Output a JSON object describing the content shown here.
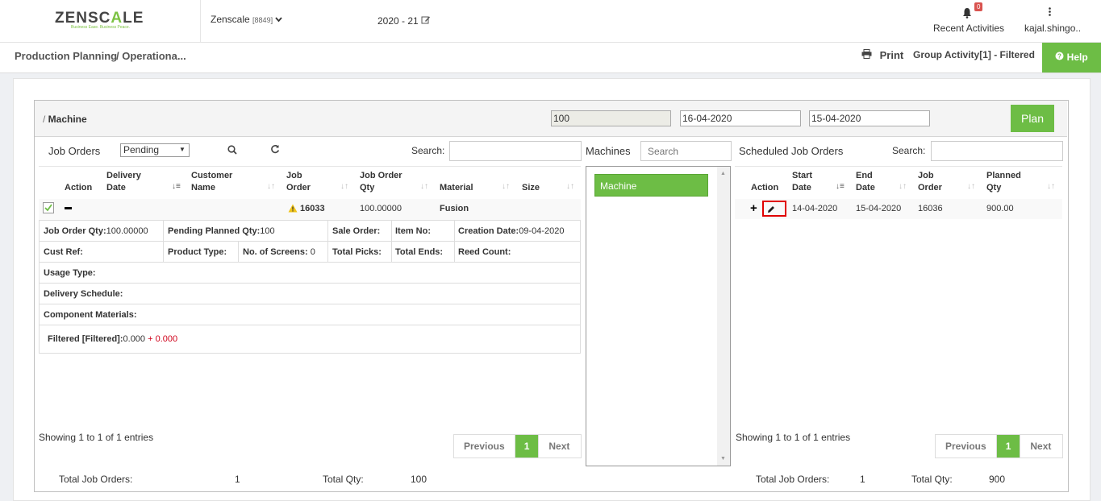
{
  "header": {
    "logo_prefix": "ZENSC",
    "logo_accent": "A",
    "logo_suffix": "LE",
    "logo_tagline": "Business Ease. Business Peace.",
    "company": "Zenscale",
    "company_code": "[8849]",
    "fiscal_year": "2020 - 21",
    "notification_count": "0",
    "recent_activities": "Recent Activities",
    "user": "kajal.shingo.."
  },
  "breadcrumb": {
    "item1": "Production Planning",
    "item2": "/ Operationa..."
  },
  "toolbar": {
    "print": "Print",
    "group_activity": "Group Activity[1] - Filtered",
    "help": "Help"
  },
  "panel": {
    "title_prefix": "/ ",
    "title": "Machine",
    "capacity": "100",
    "from_date": "16-04-2020",
    "to_date": "15-04-2020",
    "plan_label": "Plan"
  },
  "job_orders": {
    "title": "Job Orders",
    "filter": "Pending",
    "search_label": "Search:",
    "columns": [
      "Action",
      "Delivery Date",
      "Customer Name",
      "Job Order",
      "Job Order Qty",
      "Material",
      "Size"
    ],
    "row": {
      "job_order": "16033",
      "qty": "100.00000",
      "material": "Fusion"
    },
    "detail": {
      "jo_qty_label": "Job Order Qty:",
      "jo_qty": "100.00000",
      "pending_label": "Pending Planned Qty:",
      "pending": "100",
      "sale_order": "Sale Order:",
      "item_no": "Item No:",
      "creation_label": "Creation Date:",
      "creation": "09-04-2020",
      "cust_ref": "Cust Ref:",
      "product_type": "Product Type:",
      "screens_label": "No. of Screens:",
      "screens": "0",
      "total_picks": "Total Picks:",
      "total_ends": "Total Ends:",
      "reed_count": "Reed Count:",
      "usage_type": "Usage Type:",
      "delivery_schedule": "Delivery Schedule:",
      "component_materials": "Component Materials:",
      "filtered_label": "Filtered [Filtered]:",
      "filtered_value": "0.000",
      "filtered_extra": "+ 0.000"
    },
    "showing": "Showing 1 to 1 of 1 entries",
    "pager": {
      "prev": "Previous",
      "page": "1",
      "next": "Next"
    },
    "totals": {
      "jo_label": "Total Job Orders:",
      "jo_value": "1",
      "qty_label": "Total Qty:",
      "qty_value": "100"
    }
  },
  "machines": {
    "title": "Machines",
    "search_placeholder": "Search",
    "items": [
      "Machine"
    ]
  },
  "scheduled": {
    "title": "Scheduled Job Orders",
    "search_label": "Search:",
    "columns": [
      "Action",
      "Start Date",
      "End Date",
      "Job Order",
      "Planned Qty"
    ],
    "row": {
      "start": "14-04-2020",
      "end": "15-04-2020",
      "job_order": "16036",
      "planned_qty": "900.00"
    },
    "showing": "Showing 1 to 1 of 1 entries",
    "pager": {
      "prev": "Previous",
      "page": "1",
      "next": "Next"
    },
    "totals": {
      "jo_label": "Total Job Orders:",
      "jo_value": "1",
      "qty_label": "Total Qty:",
      "qty_value": "900"
    }
  },
  "colors": {
    "accent": "#6dbd45",
    "badge": "#d9534f",
    "highlight": "#e00000"
  }
}
